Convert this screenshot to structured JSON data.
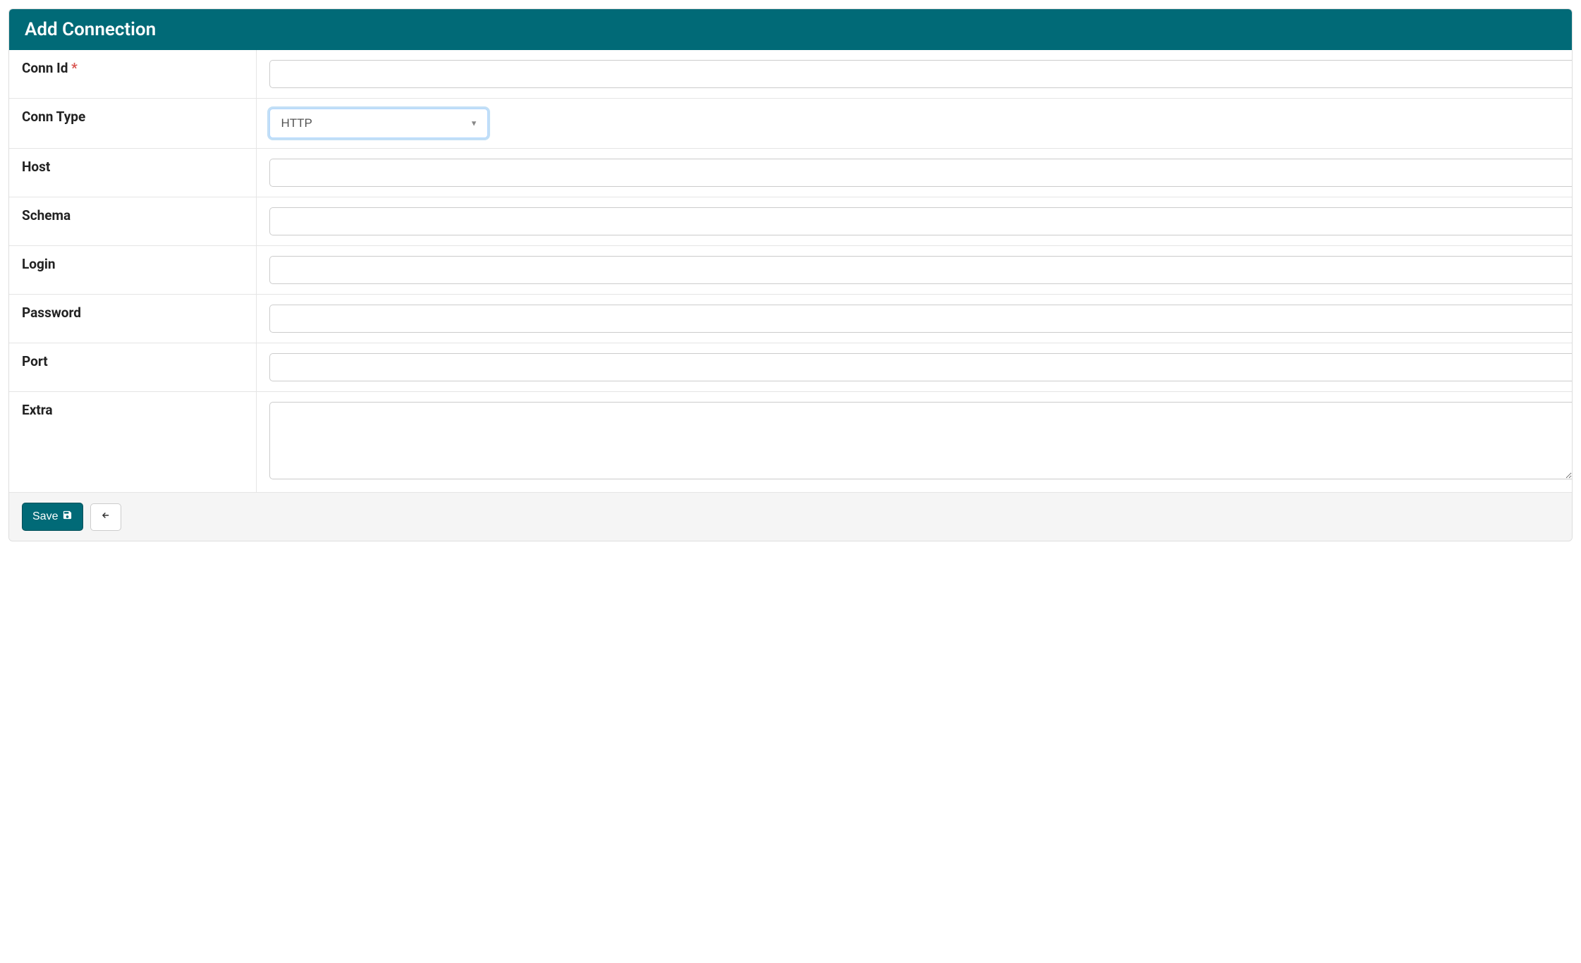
{
  "header": {
    "title": "Add Connection"
  },
  "form": {
    "conn_id": {
      "label": "Conn Id",
      "required_mark": "*",
      "value": ""
    },
    "conn_type": {
      "label": "Conn Type",
      "selected": "HTTP"
    },
    "host": {
      "label": "Host",
      "value": ""
    },
    "schema": {
      "label": "Schema",
      "value": ""
    },
    "login": {
      "label": "Login",
      "value": ""
    },
    "password": {
      "label": "Password",
      "value": ""
    },
    "port": {
      "label": "Port",
      "value": ""
    },
    "extra": {
      "label": "Extra",
      "value": ""
    }
  },
  "footer": {
    "save_label": "Save"
  }
}
